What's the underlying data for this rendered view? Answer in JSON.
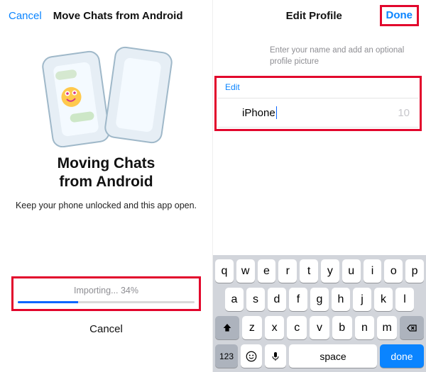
{
  "left": {
    "cancel_top": "Cancel",
    "header_title": "Move Chats from Android",
    "big_title_l1": "Moving Chats",
    "big_title_l2": "from Android",
    "subtitle": "Keep your phone unlocked and this app open.",
    "progress_label": "Importing... 34%",
    "progress_pct": 34,
    "cancel_bottom": "Cancel"
  },
  "right": {
    "title": "Edit Profile",
    "done": "Done",
    "hint": "Enter your name and add an optional profile picture",
    "edit_label": "Edit",
    "name_value": "iPhone",
    "name_count": "10"
  },
  "keyboard": {
    "row1": [
      "q",
      "w",
      "e",
      "r",
      "t",
      "y",
      "u",
      "i",
      "o",
      "p"
    ],
    "row2": [
      "a",
      "s",
      "d",
      "f",
      "g",
      "h",
      "j",
      "k",
      "l"
    ],
    "row3": [
      "z",
      "x",
      "c",
      "v",
      "b",
      "n",
      "m"
    ],
    "key_123": "123",
    "key_space": "space",
    "key_done": "done"
  }
}
